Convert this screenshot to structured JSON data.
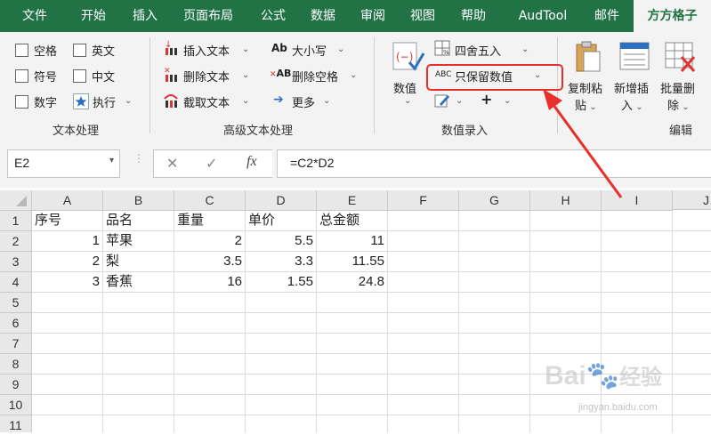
{
  "ribbon_tabs": [
    "文件",
    "开始",
    "插入",
    "页面布局",
    "公式",
    "数据",
    "审阅",
    "视图",
    "帮助",
    "AudTool",
    "邮件",
    "方方格子"
  ],
  "active_tab": "方方格子",
  "text_group": {
    "items": [
      "空格",
      "英文",
      "符号",
      "中文",
      "数字",
      "执行"
    ],
    "name": "文本处理"
  },
  "advanced_text_group": {
    "items": [
      "插入文本",
      "删除文本",
      "截取文本",
      "大小写",
      "删除空格",
      "更多"
    ],
    "case_icon": "Ab",
    "trim_icon": "AB",
    "name": "高级文本处理"
  },
  "number_group": {
    "big_button": "数值",
    "round_label": "四舍五入",
    "keep_value_label": "只保留数值",
    "keep_value_icon": "ABC",
    "plus_label": "+",
    "name": "数值录入"
  },
  "edit_group": {
    "copy_paste": [
      "复制粘",
      "贴"
    ],
    "add_insert": [
      "新增插",
      "入"
    ],
    "batch_delete": [
      "批量删",
      "除"
    ],
    "name": "编辑"
  },
  "name_box": "E2",
  "fx_label": "fx",
  "formula": "=C2*D2",
  "columns": [
    "A",
    "B",
    "C",
    "D",
    "E",
    "F",
    "G",
    "H",
    "I",
    "J"
  ],
  "rows": [
    "1",
    "2",
    "3",
    "4",
    "5",
    "6",
    "7",
    "8",
    "9",
    "10",
    "11"
  ],
  "cells": {
    "r1": [
      "序号",
      "品名",
      "重量",
      "单价",
      "总金额"
    ],
    "r2": [
      "1",
      "苹果",
      "2",
      "5.5",
      "11"
    ],
    "r3": [
      "2",
      "梨",
      "3.5",
      "3.3",
      "11.55"
    ],
    "r4": [
      "3",
      "香蕉",
      "16",
      "1.55",
      "24.8"
    ]
  },
  "watermark": [
    "Bai",
    "经验",
    "jingyan.baidu.com"
  ],
  "colors": {
    "excel_green": "#217346",
    "highlight_red": "#e8302b"
  }
}
